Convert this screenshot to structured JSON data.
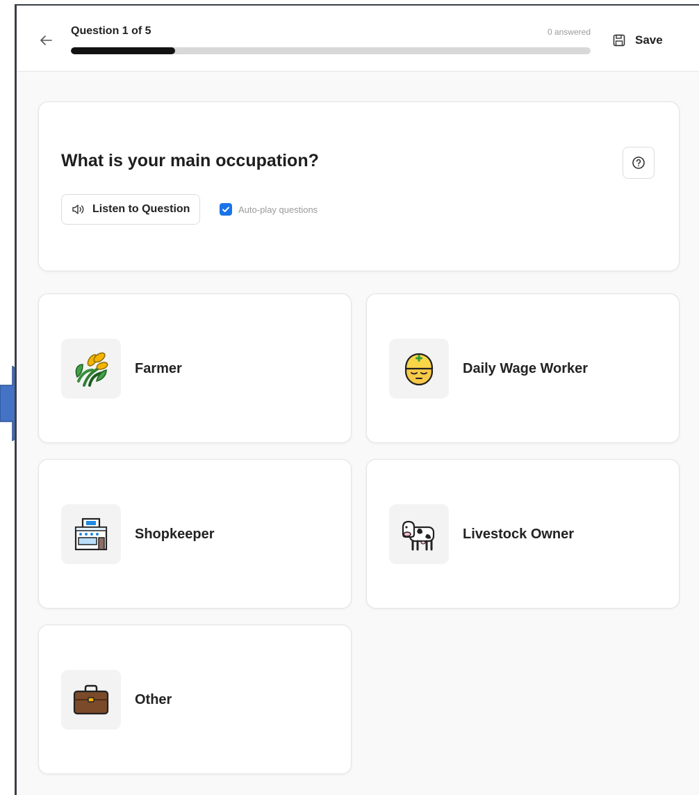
{
  "header": {
    "question_counter": "Question 1 of 5",
    "answered_text": "0 answered",
    "progress_fraction": 0.2,
    "save_label": "Save"
  },
  "question": {
    "title": "What is your main occupation?",
    "listen_label": "Listen to Question",
    "autoplay_label": "Auto-play questions",
    "autoplay_checked": true
  },
  "options": [
    {
      "label": "Farmer",
      "icon": "sheaf-of-rice-icon"
    },
    {
      "label": "Daily Wage Worker",
      "icon": "construction-worker-icon"
    },
    {
      "label": "Shopkeeper",
      "icon": "convenience-store-icon"
    },
    {
      "label": "Livestock Owner",
      "icon": "cow-icon"
    },
    {
      "label": "Other",
      "icon": "briefcase-icon"
    }
  ],
  "colors": {
    "accent": "#1a73e8",
    "progress_fill": "#121212",
    "pointer_arrow": "#4472c4"
  }
}
